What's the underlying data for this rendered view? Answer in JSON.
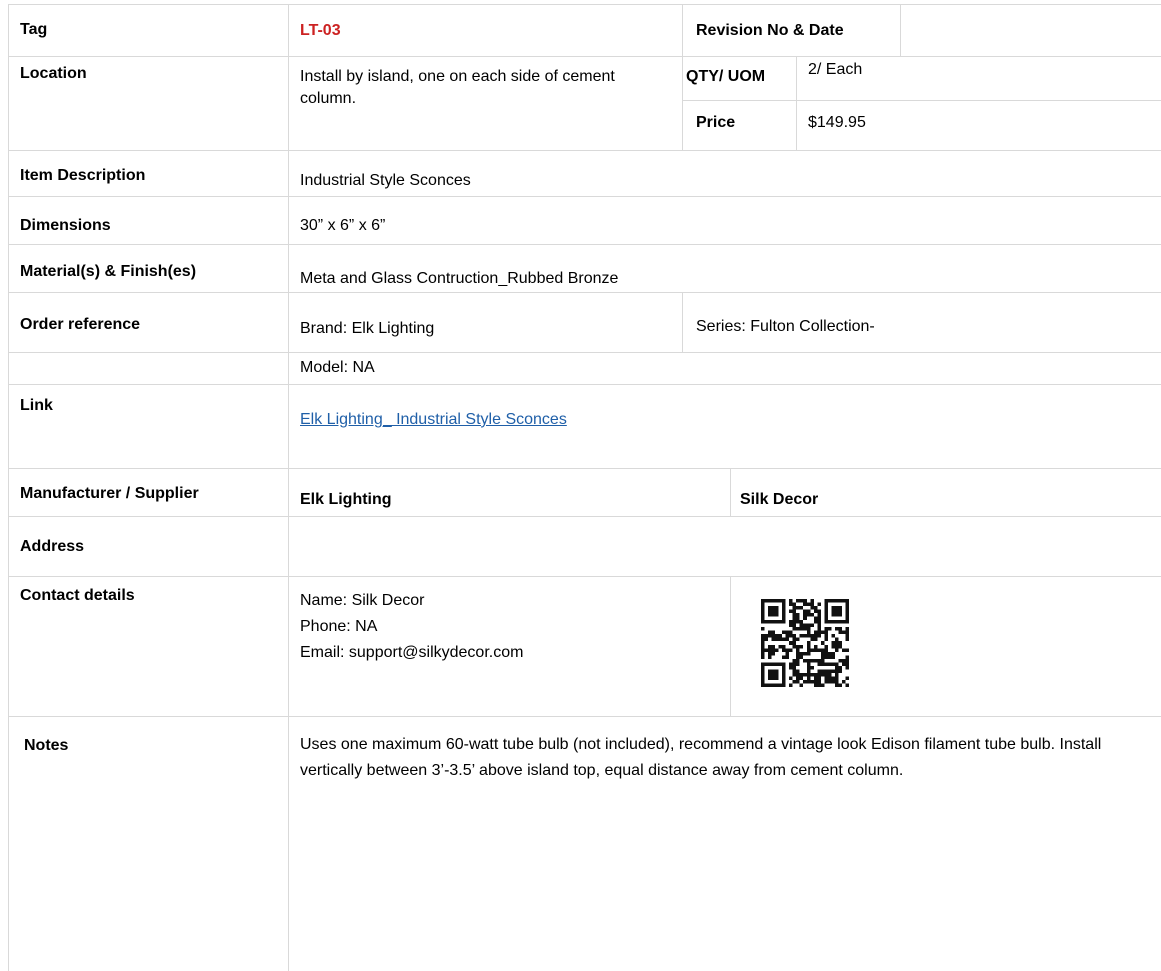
{
  "tag": {
    "label": "Tag",
    "value": "LT-03"
  },
  "revision": {
    "label": "Revision No & Date",
    "value": ""
  },
  "location": {
    "label": "Location",
    "value": "Install by island, one on each side of cement column."
  },
  "qty": {
    "label": "QTY/ UOM",
    "value": "2/ Each"
  },
  "price": {
    "label": "Price",
    "value": "$149.95"
  },
  "item_description": {
    "label": "Item Description",
    "value": "Industrial Style Sconces"
  },
  "dimensions": {
    "label": "Dimensions",
    "value": "30” x 6” x 6”"
  },
  "materials": {
    "label": "Material(s) & Finish(es)",
    "value": "Meta and Glass Contruction_Rubbed Bronze"
  },
  "order_reference": {
    "label": "Order reference",
    "brand": "Brand: Elk Lighting",
    "series": "Series: Fulton Collection-",
    "model": "Model: NA"
  },
  "link": {
    "label": "Link",
    "text": "Elk Lighting_ Industrial Style Sconces"
  },
  "manufacturer": {
    "label": "Manufacturer / Supplier",
    "manufacturer": "Elk Lighting",
    "supplier": "Silk Decor"
  },
  "address": {
    "label": "Address",
    "value": ""
  },
  "contact": {
    "label": "Contact details",
    "name": "Name:  Silk Decor",
    "phone": "Phone: NA",
    "email": "Email:  support@silkydecor.com"
  },
  "notes": {
    "label": "Notes",
    "value": "Uses one maximum 60-watt tube bulb (not included), recommend a vintage look Edison filament tube bulb. Install vertically between 3’-3.5’ above island top, equal distance away from cement column."
  },
  "colors": {
    "tag_value": "#cc2222",
    "link": "#1f5fa8",
    "grid": "#d9d9d9"
  },
  "icons": [
    "qr-code-icon"
  ]
}
